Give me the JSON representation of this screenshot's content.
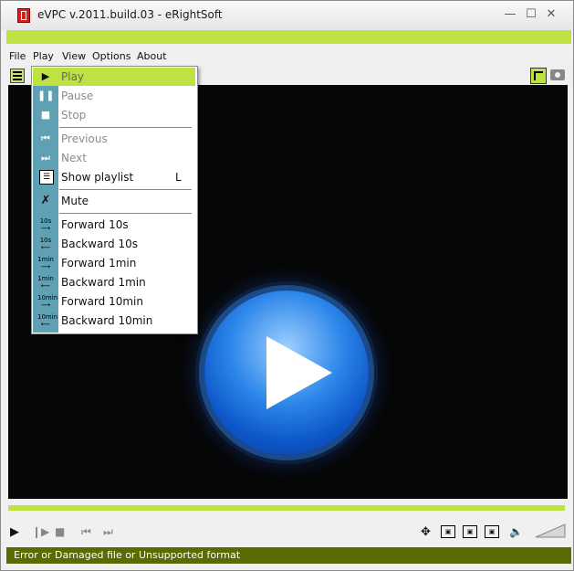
{
  "window": {
    "title": "eVPC v.2011.build.03 - eRightSoft"
  },
  "menubar": {
    "items": [
      "File",
      "Play",
      "View",
      "Options",
      "About"
    ]
  },
  "dropdown": {
    "items": [
      {
        "label": "Play",
        "icon": "play-icon",
        "state": "selected"
      },
      {
        "label": "Pause",
        "icon": "pause-icon",
        "state": "disabled"
      },
      {
        "label": "Stop",
        "icon": "stop-icon",
        "state": "disabled"
      },
      {
        "label": "Previous",
        "icon": "previous-icon",
        "state": "disabled"
      },
      {
        "label": "Next",
        "icon": "next-icon",
        "state": "disabled"
      },
      {
        "label": "Show playlist",
        "icon": "playlist-icon",
        "accel": "L",
        "state": "normal"
      },
      {
        "label": "Mute",
        "icon": "mute-icon",
        "state": "normal"
      },
      {
        "label": "Forward 10s",
        "icon": "forward-10s-icon",
        "state": "normal"
      },
      {
        "label": "Backward 10s",
        "icon": "backward-10s-icon",
        "state": "normal"
      },
      {
        "label": "Forward 1min",
        "icon": "forward-1min-icon",
        "state": "normal"
      },
      {
        "label": "Backward 1min",
        "icon": "backward-1min-icon",
        "state": "normal"
      },
      {
        "label": "Forward 10min",
        "icon": "forward-10min-icon",
        "state": "normal"
      },
      {
        "label": "Backward 10min",
        "icon": "backward-10min-icon",
        "state": "normal"
      }
    ],
    "icon_texts": {
      "t10s": "10s",
      "t1min": "1min",
      "t10min": "10min"
    }
  },
  "status": {
    "text": "Error or Damaged file or Unsupported format"
  },
  "colors": {
    "accent": "#bfe243",
    "status_bg": "#5b6a02",
    "menu_gutter": "#5fa0b5",
    "video_bg": "#060606"
  }
}
